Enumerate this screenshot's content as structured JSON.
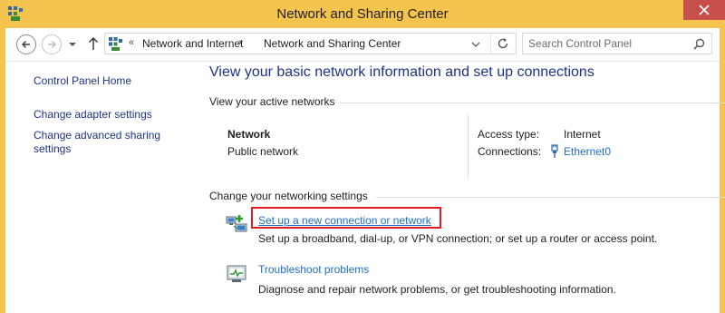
{
  "window": {
    "title": "Network and Sharing Center",
    "icon": "network-sharing-icon",
    "frame_color": "#f5c44e",
    "close_color": "#c7504b"
  },
  "navbar": {
    "back_icon": "back-arrow-icon",
    "forward_icon": "forward-arrow-icon",
    "recent_icon": "chevron-down-icon",
    "up_icon": "up-arrow-icon",
    "address": {
      "overflow": "«",
      "crumbs": [
        "Network and Internet",
        "Network and Sharing Center"
      ],
      "separator": "›"
    },
    "search": {
      "placeholder": "Search Control Panel",
      "value": ""
    }
  },
  "left_pane": {
    "links": [
      "Control Panel Home",
      "Change adapter settings",
      "Change advanced sharing settings"
    ]
  },
  "main": {
    "heading": "View your basic network information and set up connections",
    "active_networks": {
      "title": "View your active networks",
      "network_name": "Network",
      "network_type": "Public network",
      "access_type_label": "Access type:",
      "access_type_value": "Internet",
      "connections_label": "Connections:",
      "connections_value": "Ethernet0"
    },
    "settings": {
      "title": "Change your networking settings",
      "tasks": [
        {
          "link": "Set up a new connection or network",
          "description": "Set up a broadband, dial-up, or VPN connection; or set up a router or access point.",
          "icon": "new-connection-icon",
          "highlighted": true
        },
        {
          "link": "Troubleshoot problems",
          "description": "Diagnose and repair network problems, or get troubleshooting information.",
          "icon": "troubleshoot-icon",
          "highlighted": false
        }
      ]
    },
    "colors": {
      "heading": "#1e3287",
      "link": "#1e6ec8",
      "highlight": "#e41b23"
    }
  }
}
